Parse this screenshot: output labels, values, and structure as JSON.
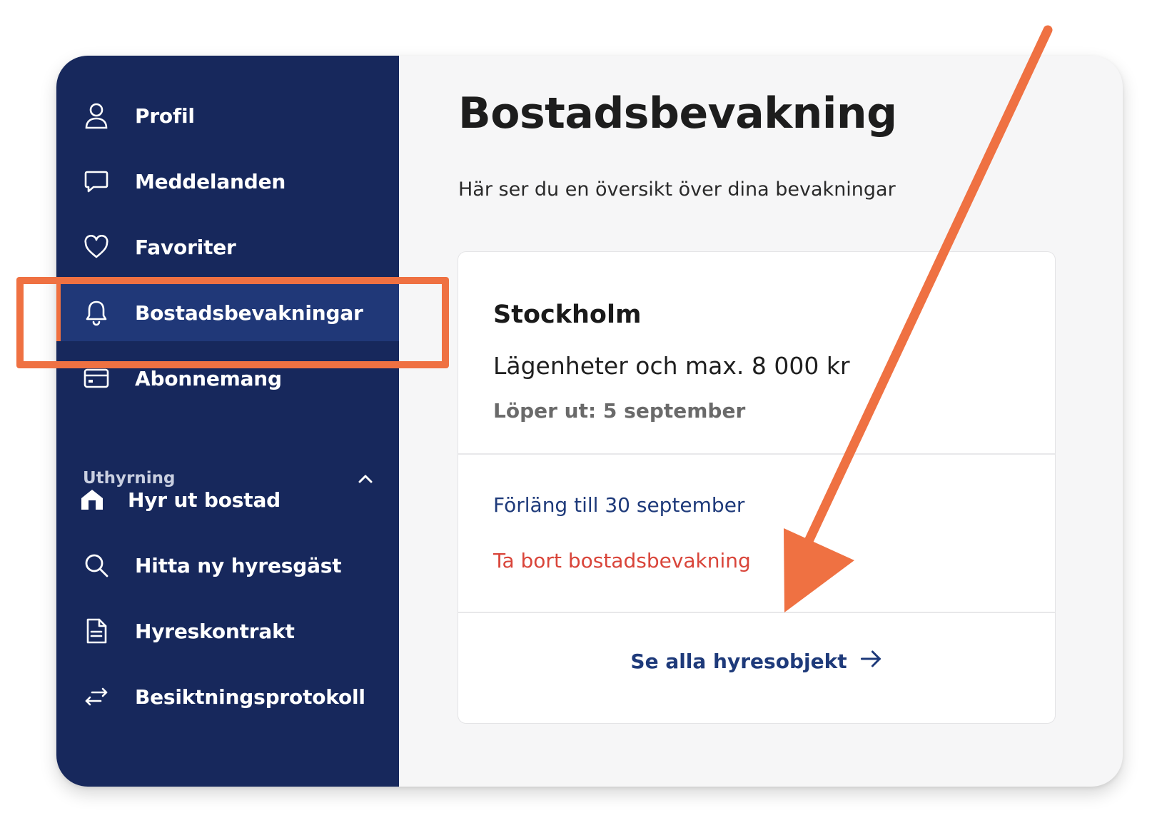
{
  "sidebar": {
    "items": [
      {
        "label": "Profil",
        "icon": "user-icon"
      },
      {
        "label": "Meddelanden",
        "icon": "chat-bubble-icon"
      },
      {
        "label": "Favoriter",
        "icon": "heart-icon"
      },
      {
        "label": "Bostadsbevakningar",
        "icon": "bell-icon",
        "active": true
      },
      {
        "label": "Abonnemang",
        "icon": "credit-card-icon"
      }
    ],
    "section": {
      "label": "Uthyrning",
      "expanded": true,
      "items": [
        {
          "label": "Hyr ut bostad",
          "icon": "house-icon"
        },
        {
          "label": "Hitta ny hyresgäst",
          "icon": "search-icon"
        },
        {
          "label": "Hyreskontrakt",
          "icon": "document-icon"
        },
        {
          "label": "Besiktningsprotokoll",
          "icon": "swap-arrows-icon"
        }
      ]
    }
  },
  "main": {
    "title": "Bostadsbevakning",
    "subtitle": "Här ser du en översikt över dina bevakningar"
  },
  "watch": {
    "city": "Stockholm",
    "description": "Lägenheter och max. 8 000 kr",
    "expires": "Löper ut: 5 september",
    "extend_link": "Förläng till 30 september",
    "remove_link": "Ta bort bostadsbevakning",
    "see_all": "Se alla hyresobjekt"
  },
  "colors": {
    "sidebar_bg": "#17285c",
    "sidebar_active_bg": "#203878",
    "accent_orange": "#ef7142",
    "link_blue": "#1e3a7a",
    "danger_red": "#d9453a"
  }
}
